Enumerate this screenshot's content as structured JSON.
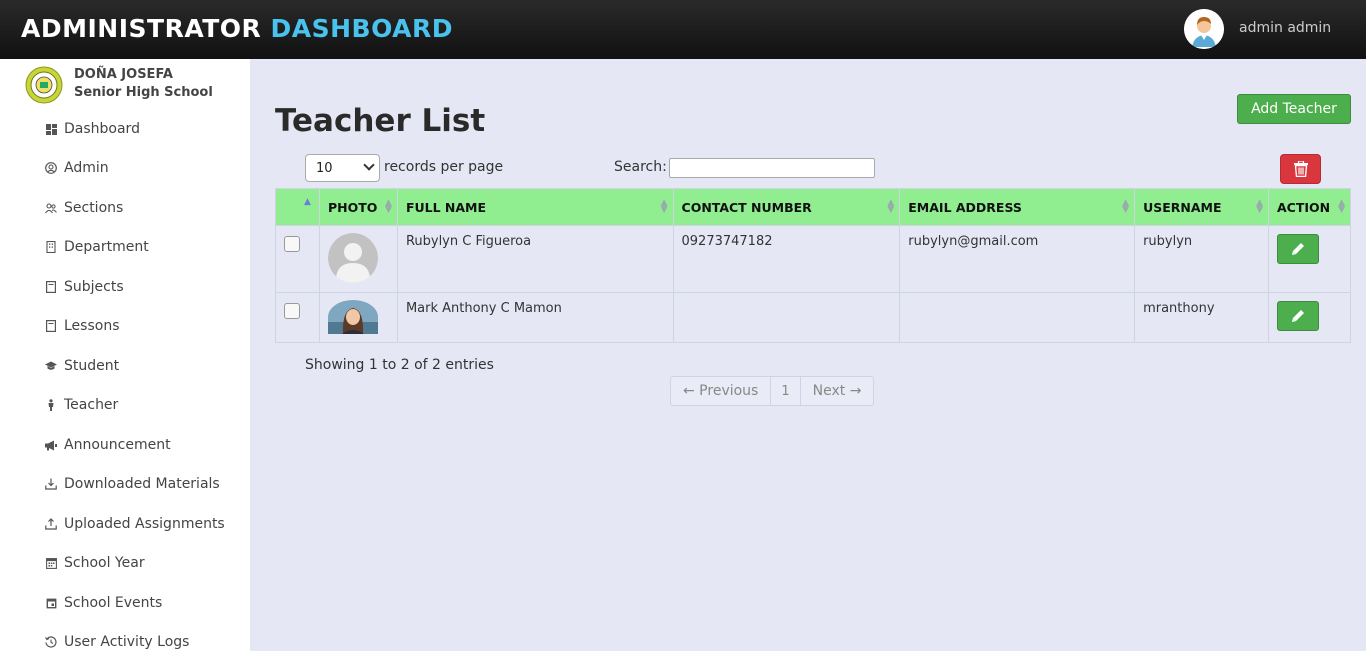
{
  "header": {
    "title_part1": "ADMINISTRATOR",
    "title_part2": "DASHBOARD",
    "user_name": "admin admin"
  },
  "sidebar": {
    "school_name_line1": "DOÑA JOSEFA",
    "school_name_line2": "Senior High School",
    "items": [
      {
        "label": "Dashboard",
        "icon": "dashboard-icon"
      },
      {
        "label": "Admin",
        "icon": "user-circle-icon"
      },
      {
        "label": "Sections",
        "icon": "users-icon"
      },
      {
        "label": "Department",
        "icon": "building-icon"
      },
      {
        "label": "Subjects",
        "icon": "book-icon"
      },
      {
        "label": "Lessons",
        "icon": "book-icon"
      },
      {
        "label": "Student",
        "icon": "graduation-cap-icon"
      },
      {
        "label": "Teacher",
        "icon": "person-icon"
      },
      {
        "label": "Announcement",
        "icon": "megaphone-icon"
      },
      {
        "label": "Downloaded Materials",
        "icon": "download-icon"
      },
      {
        "label": "Uploaded Assignments",
        "icon": "upload-icon"
      },
      {
        "label": "School Year",
        "icon": "calendar-icon"
      },
      {
        "label": "School Events",
        "icon": "calendar-event-icon"
      },
      {
        "label": "User Activity Logs",
        "icon": "history-icon"
      }
    ]
  },
  "main": {
    "page_title": "Teacher List",
    "add_button": "Add Teacher",
    "records_select_value": "10",
    "records_label": "records per page",
    "search_label": "Search:",
    "search_value": "",
    "columns": [
      "",
      "PHOTO",
      "FULL NAME",
      "CONTACT NUMBER",
      "EMAIL ADDRESS",
      "USERNAME",
      "ACTION"
    ],
    "rows": [
      {
        "full_name": "Rubylyn C Figueroa",
        "contact": "09273747182",
        "email": "rubylyn@gmail.com",
        "username": "rubylyn",
        "photo": "default-avatar"
      },
      {
        "full_name": "Mark Anthony C Mamon",
        "contact": "",
        "email": "",
        "username": "mranthony",
        "photo": "portrait-photo"
      }
    ],
    "info": "Showing 1 to 2 of 2 entries",
    "pager": {
      "prev": "← Previous",
      "current": "1",
      "next": "Next →"
    }
  },
  "colors": {
    "accent": "#49c2ee",
    "header_row": "#90ee90",
    "success": "#4cae4c",
    "danger": "#d9363e",
    "background": "#e5e8f4"
  }
}
